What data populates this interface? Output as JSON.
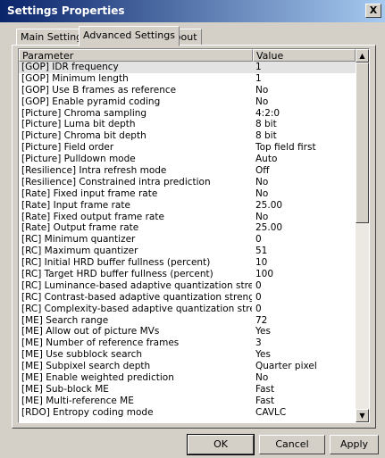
{
  "window": {
    "title": "Settings Properties",
    "close_label": "X"
  },
  "tabs": [
    {
      "label": "Main Settings",
      "active": false
    },
    {
      "label": "Advanced Settings",
      "active": true
    },
    {
      "label": "About",
      "active": false
    }
  ],
  "grid": {
    "columns": {
      "parameter": "Parameter",
      "value": "Value"
    },
    "rows": [
      {
        "param": "[GOP] IDR frequency",
        "value": "1"
      },
      {
        "param": "[GOP] Minimum length",
        "value": "1"
      },
      {
        "param": "[GOP] Use B frames as reference",
        "value": "No"
      },
      {
        "param": "[GOP] Enable pyramid coding",
        "value": "No"
      },
      {
        "param": "[Picture] Chroma sampling",
        "value": "4:2:0"
      },
      {
        "param": "[Picture] Luma bit depth",
        "value": "8 bit"
      },
      {
        "param": "[Picture] Chroma bit depth",
        "value": "8 bit"
      },
      {
        "param": "[Picture] Field order",
        "value": "Top field first"
      },
      {
        "param": "[Picture] Pulldown mode",
        "value": "Auto"
      },
      {
        "param": "[Resilience] Intra refresh mode",
        "value": "Off"
      },
      {
        "param": "[Resilience] Constrained intra prediction",
        "value": "No"
      },
      {
        "param": "[Rate] Fixed input frame rate",
        "value": "No"
      },
      {
        "param": "[Rate] Input frame rate",
        "value": "25.00"
      },
      {
        "param": "[Rate] Fixed output frame rate",
        "value": "No"
      },
      {
        "param": "[Rate] Output frame rate",
        "value": "25.00"
      },
      {
        "param": "[RC] Minimum quantizer",
        "value": "0"
      },
      {
        "param": "[RC] Maximum quantizer",
        "value": "51"
      },
      {
        "param": "[RC] Initial HRD buffer fullness (percent)",
        "value": "10"
      },
      {
        "param": "[RC] Target HRD buffer fullness (percent)",
        "value": "100"
      },
      {
        "param": "[RC] Luminance-based adaptive quantization strength",
        "value": "0"
      },
      {
        "param": "[RC] Contrast-based adaptive quantization strength",
        "value": "0"
      },
      {
        "param": "[RC] Complexity-based adaptive quantization strength",
        "value": "0"
      },
      {
        "param": "[ME] Search range",
        "value": "72"
      },
      {
        "param": "[ME] Allow out of picture MVs",
        "value": "Yes"
      },
      {
        "param": "[ME] Number of reference frames",
        "value": "3"
      },
      {
        "param": "[ME] Use subblock search",
        "value": "Yes"
      },
      {
        "param": "[ME] Subpixel search depth",
        "value": "Quarter pixel"
      },
      {
        "param": "[ME] Enable weighted prediction",
        "value": "No"
      },
      {
        "param": "[ME] Sub-block ME",
        "value": "Fast"
      },
      {
        "param": "[ME] Multi-reference ME",
        "value": "Fast"
      },
      {
        "param": "[RDO] Entropy coding mode",
        "value": "CAVLC"
      }
    ]
  },
  "scrollbar": {
    "up_glyph": "▲",
    "down_glyph": "▼"
  },
  "buttons": {
    "ok": "OK",
    "cancel": "Cancel",
    "apply": "Apply"
  },
  "colors": {
    "title_start": "#0a246a",
    "title_end": "#a6caf0",
    "face": "#d4d0c8",
    "selected_row": "#e3e3e3"
  },
  "icons": {
    "close": "close-icon",
    "scroll_up": "arrow-up-icon",
    "scroll_down": "arrow-down-icon"
  }
}
